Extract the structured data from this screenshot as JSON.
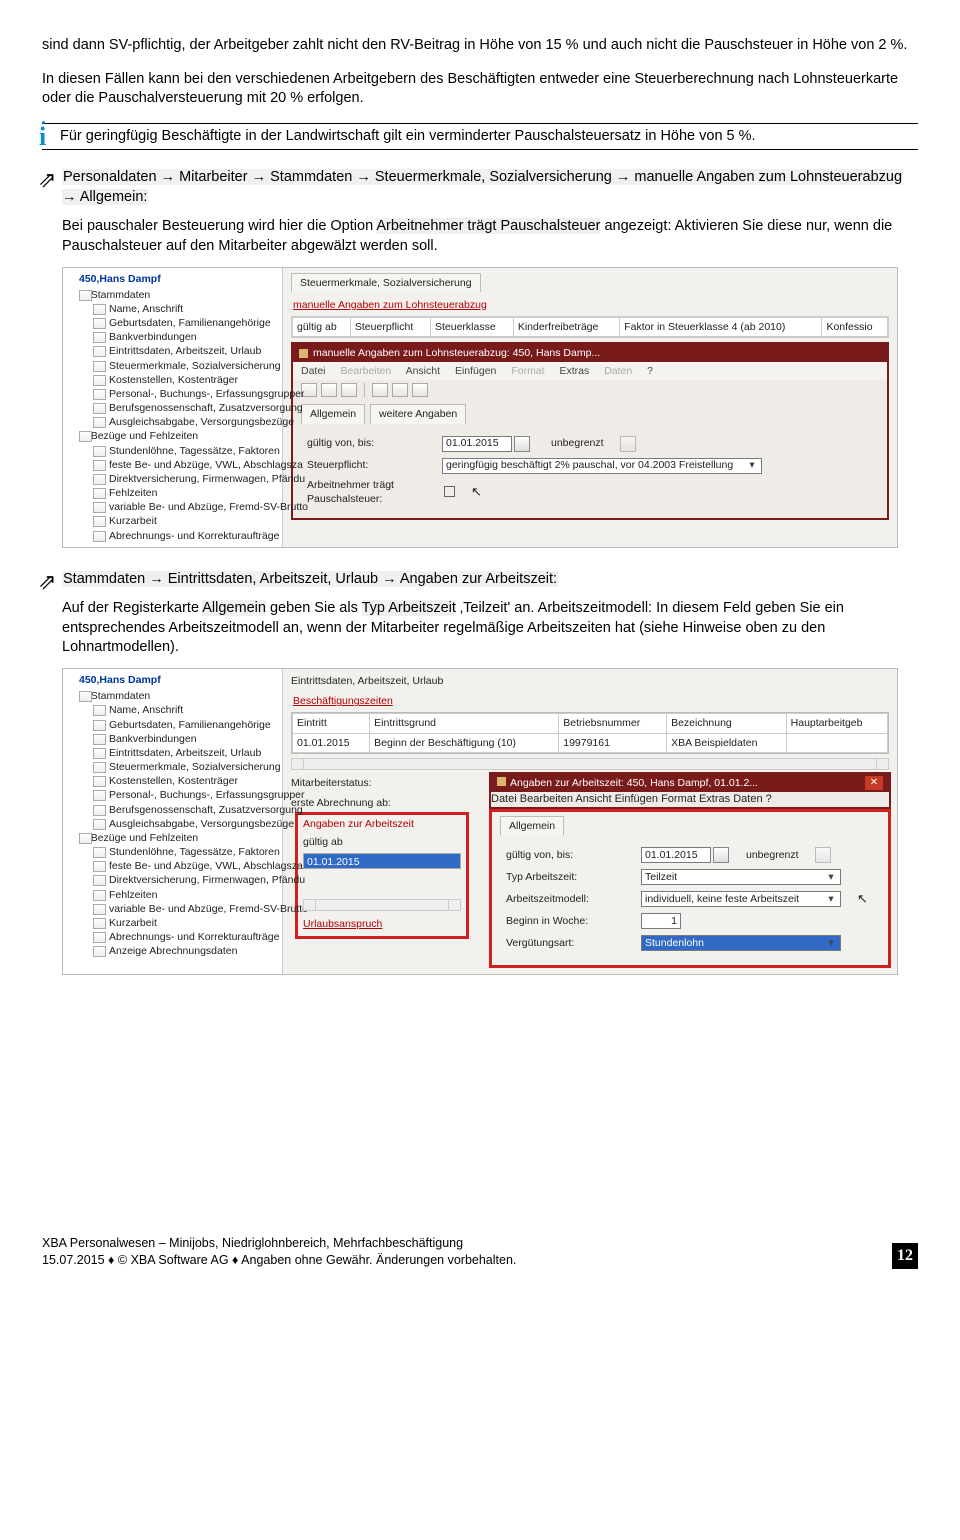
{
  "intro": {
    "p1": "sind dann SV-pflichtig, der Arbeitgeber zahlt nicht den RV-Beitrag in Höhe von 15 % und auch nicht die Pauschsteuer in Höhe von 2 %.",
    "p2": "In diesen Fällen kann bei den verschiedenen Arbeitgebern des Beschäftigten entweder eine Steuerberechnung nach Lohnsteuerkarte oder die Pauschalversteuerung mit 20 % erfolgen."
  },
  "info": "Für geringfügig Beschäftigte in der Landwirtschaft gilt ein verminderter Pauschalsteuersatz in Höhe von 5 %.",
  "sec1": {
    "path": "Personaldaten → Mitarbeiter → Stammdaten → Steuermerkmale, Sozialversicherung → manuelle Angaben zum Lohnsteuerabzug → Allgemein:",
    "body_a": "Bei pauschaler Besteuerung wird hier die Option ",
    "body_hl": "Arbeitnehmer trägt Pauschalsteuer",
    "body_b": " angezeigt: Aktivieren Sie diese nur, wenn die Pauschalsteuer auf den Mitarbeiter abgewälzt werden soll."
  },
  "shot1": {
    "root": "450,Hans Dampf",
    "tree_groups": [
      "Stammdaten",
      "Bezüge und Fehlzeiten"
    ],
    "tree_items_a": [
      "Name, Anschrift",
      "Geburtsdaten, Familienangehörige",
      "Bankverbindungen",
      "Eintrittsdaten, Arbeitszeit, Urlaub",
      "Steuermerkmale, Sozialversicherung",
      "Kostenstellen, Kostenträger",
      "Personal-, Buchungs-, Erfassungsgrupper",
      "Berufsgenossenschaft, Zusatzversorgung",
      "Ausgleichsabgabe, Versorgungsbezüge"
    ],
    "tree_items_b": [
      "Stundenlöhne, Tagessätze, Faktoren",
      "feste Be- und Abzüge, VWL, Abschlagsza",
      "Direktversicherung, Firmenwagen, Pfändu",
      "Fehlzeiten",
      "variable Be- und Abzüge, Fremd-SV-Brutto",
      "Kurzarbeit",
      "Abrechnungs- und Korrekturaufträge"
    ],
    "tab_top": "Steuermerkmale, Sozialversicherung",
    "redlink": "manuelle Angaben zum Lohnsteuerabzug",
    "hdr_cols": [
      "gültig ab",
      "Steuerpflicht",
      "Steuerklasse",
      "Kinderfreibeträge",
      "Faktor in Steuerklasse 4 (ab 2010)",
      "Konfessio"
    ],
    "modal_title": "manuelle Angaben zum Lohnsteuerabzug: 450, Hans Damp...",
    "menu": [
      "Datei",
      "Bearbeiten",
      "Ansicht",
      "Einfügen",
      "Format",
      "Extras",
      "Daten",
      "?"
    ],
    "innertabs": [
      "Allgemein",
      "weitere Angaben"
    ],
    "lab1": "gültig von, bis:",
    "val1a": "01.01.2015",
    "val1b": "unbegrenzt",
    "lab2": "Steuerpflicht:",
    "val2": "geringfügig beschäftigt 2% pauschal, vor 04.2003 Freistellung",
    "lab3": "Arbeitnehmer trägt Pauschalsteuer:"
  },
  "sec2": {
    "path": "Stammdaten → Eintrittsdaten, Arbeitszeit, Urlaub → Angaben zur Arbeitszeit:",
    "body_a": "Auf der Registerkarte ",
    "body_hl1": "Allgemein",
    "body_b": " geben Sie als ",
    "body_hl2": "Typ Arbeitszeit",
    "body_c": " ‚Teilzeit' an. Arbeitszeitmodell: In diesem Feld geben Sie ein entsprechendes Arbeitszeitmodell an, wenn der Mitarbeiter regelmäßige Arbeitszeiten hat (siehe Hinweise oben zu den Lohnartmodellen)."
  },
  "shot2": {
    "root": "450,Hans Dampf",
    "tree_items_a": [
      "Name, Anschrift",
      "Geburtsdaten, Familienangehörige",
      "Bankverbindungen",
      "Eintrittsdaten, Arbeitszeit, Urlaub",
      "Steuermerkmale, Sozialversicherung",
      "Kostenstellen, Kostenträger",
      "Personal-, Buchungs-, Erfassungsgrupper",
      "Berufsgenossenschaft, Zusatzversorgung",
      "Ausgleichsabgabe, Versorgungsbezüge"
    ],
    "tree_items_b": [
      "Stundenlöhne, Tagessätze, Faktoren",
      "feste Be- und Abzüge, VWL, Abschlagsza",
      "Direktversicherung, Firmenwagen, Pfändu",
      "Fehlzeiten",
      "variable Be- und Abzüge, Fremd-SV-Brutto",
      "Kurzarbeit",
      "Abrechnungs- und Korrekturaufträge",
      "Anzeige Abrechnungsdaten"
    ],
    "tab_top": "Eintrittsdaten, Arbeitszeit, Urlaub",
    "redlink": "Beschäftigungszeiten",
    "tbl_cols": [
      "Eintritt",
      "Eintrittsgrund",
      "Betriebsnummer",
      "Bezeichnung",
      "Hauptarbeitgeb"
    ],
    "tbl_row": [
      "01.01.2015",
      "Beginn der Beschäftigung (10)",
      "19979161",
      "XBA Beispieldaten",
      ""
    ],
    "lab_ms": "Mitarbeiterstatus:",
    "lab_ea": "erste Abrechnung ab:",
    "angaben_hd": "Angaben zur Arbeitszeit",
    "gult_ab_lab": "gültig ab",
    "gult_ab_val": "01.01.2015",
    "modal2_title": "Angaben zur Arbeitszeit: 450, Hans Dampf, 01.01.2...",
    "innertab": "Allgemein",
    "f_lab1": "gültig von, bis:",
    "f_val1a": "01.01.2015",
    "f_val1b": "unbegrenzt",
    "f_lab2": "Typ Arbeitszeit:",
    "f_val2": "Teilzeit",
    "f_lab3": "Arbeitszeitmodell:",
    "f_val3": "individuell, keine feste Arbeitszeit",
    "f_lab4": "Beginn in Woche:",
    "f_val4": "1",
    "f_lab5": "Vergütungsart:",
    "f_val5": "Stundenlohn",
    "urlaub": "Urlaubsanspruch"
  },
  "footer": {
    "l1": "XBA Personalwesen – Minijobs, Niedriglohnbereich, Mehrfachbeschäftigung",
    "l2": "15.07.2015 ♦ © XBA Software AG ♦ Angaben ohne Gewähr. Änderungen vorbehalten.",
    "page": "12"
  }
}
